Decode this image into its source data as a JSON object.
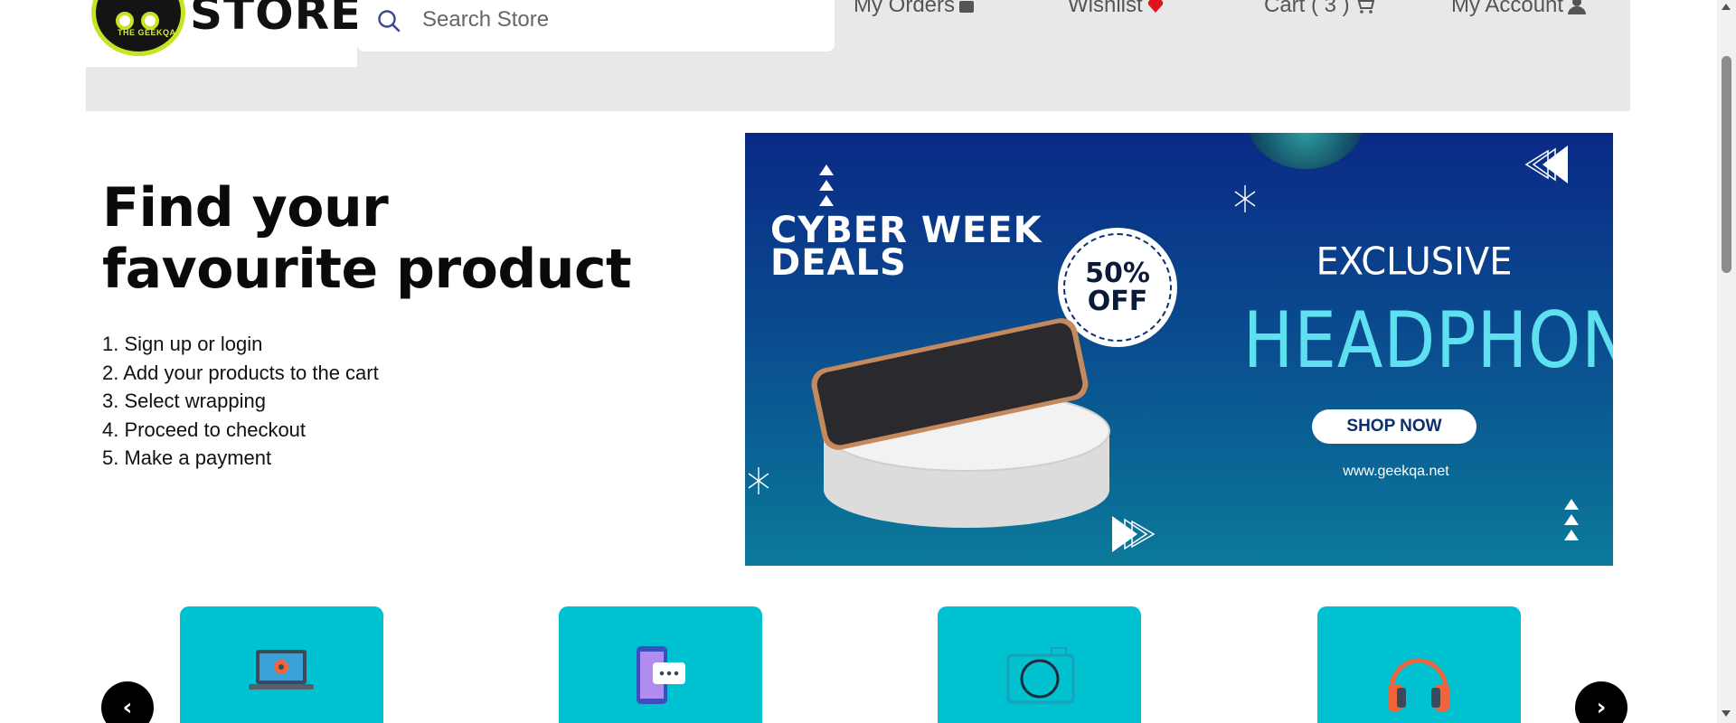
{
  "header": {
    "logo_small_text": "THE GEEKQA",
    "logo_word": "STORE",
    "search_placeholder": "Search Store",
    "nav": {
      "orders": "My Orders",
      "wishlist": "Wishlist",
      "cart": "Cart ( 3 )",
      "account": "My Account"
    }
  },
  "hero": {
    "title": "Find your favourite product",
    "steps": [
      "1. Sign up or login",
      "2. Add your products to the cart",
      "3. Select wrapping",
      "4. Proceed to checkout",
      "5. Make a payment"
    ]
  },
  "banner": {
    "deal_line1": "CYBER WEEK",
    "deal_line2": "DEALS",
    "off_line1": "50%",
    "off_line2": "OFF",
    "exclusive": "EXCLUSIVE",
    "product": "HEADPHONE",
    "cta": "SHOP NOW",
    "website": "www.geekqa.net"
  },
  "categories": {
    "icons": [
      "laptop-icon",
      "smartphone-chat-icon",
      "camera-icon",
      "headphones-icon"
    ],
    "prev_label": "‹",
    "next_label": "›"
  },
  "colors": {
    "header_bg": "#e8e8e8",
    "category_card": "#00c1d0",
    "banner_top": "#0a2a86",
    "banner_bottom": "#0b7a9a",
    "headphone_text": "#5fe0f0",
    "wishlist_heart": "#e0121a"
  }
}
